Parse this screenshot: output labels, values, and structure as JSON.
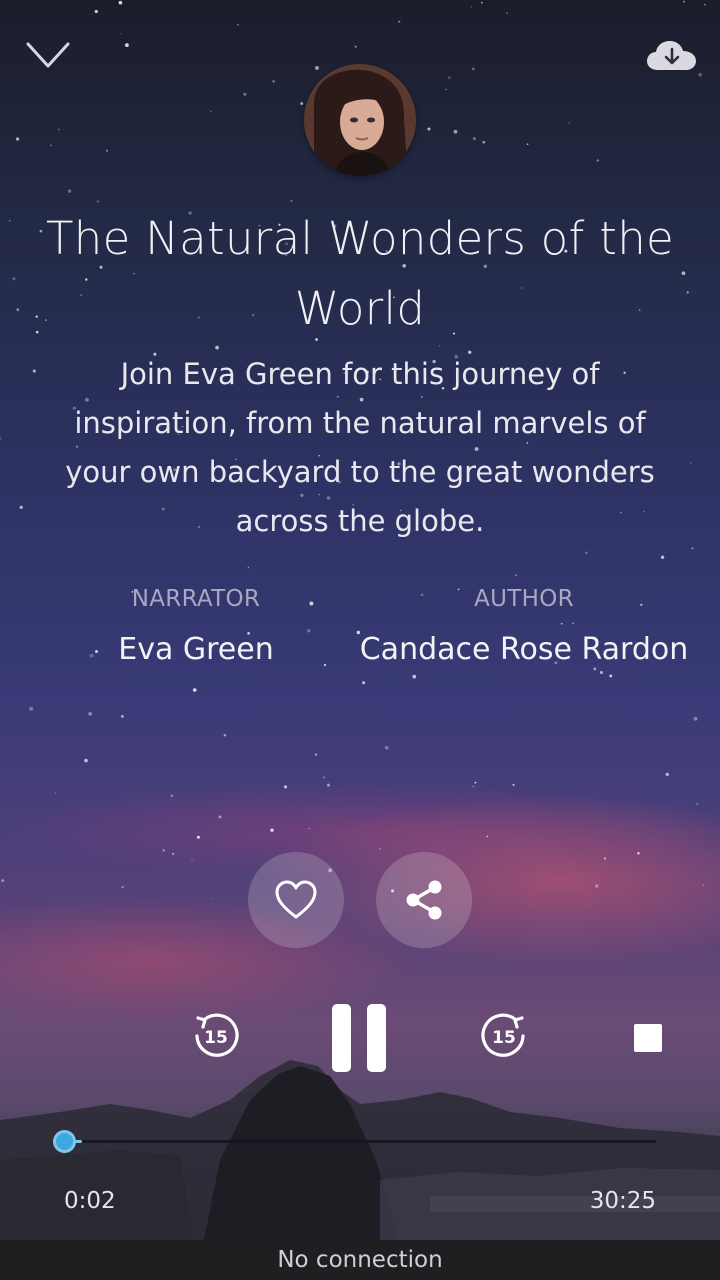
{
  "header": {
    "collapse_icon": "chevron-down-icon",
    "download_icon": "cloud-download-icon"
  },
  "track": {
    "avatar_icon": "narrator-portrait",
    "title": "The Natural Wonders of the World",
    "description": "Join Eva Green for this journey of inspiration, from the natural marvels of your own backyard to the great wonders across the globe."
  },
  "credits": {
    "narrator_label": "NARRATOR",
    "narrator_name": "Eva Green",
    "author_label": "AUTHOR",
    "author_name": "Candace Rose Rardon"
  },
  "actions": {
    "like_icon": "heart-outline-icon",
    "share_icon": "share-icon"
  },
  "controls": {
    "rewind_icon": "rewind-15-icon",
    "rewind_seconds": "15",
    "play_state_icon": "pause-icon",
    "forward_icon": "forward-15-icon",
    "forward_seconds": "15",
    "stop_icon": "stop-icon"
  },
  "progress": {
    "elapsed": "0:02",
    "duration": "30:25",
    "fraction": 0.0011
  },
  "status": {
    "message": "No connection"
  },
  "colors": {
    "accent": "#3fa7e0",
    "status_bar": "#1f1f22"
  }
}
